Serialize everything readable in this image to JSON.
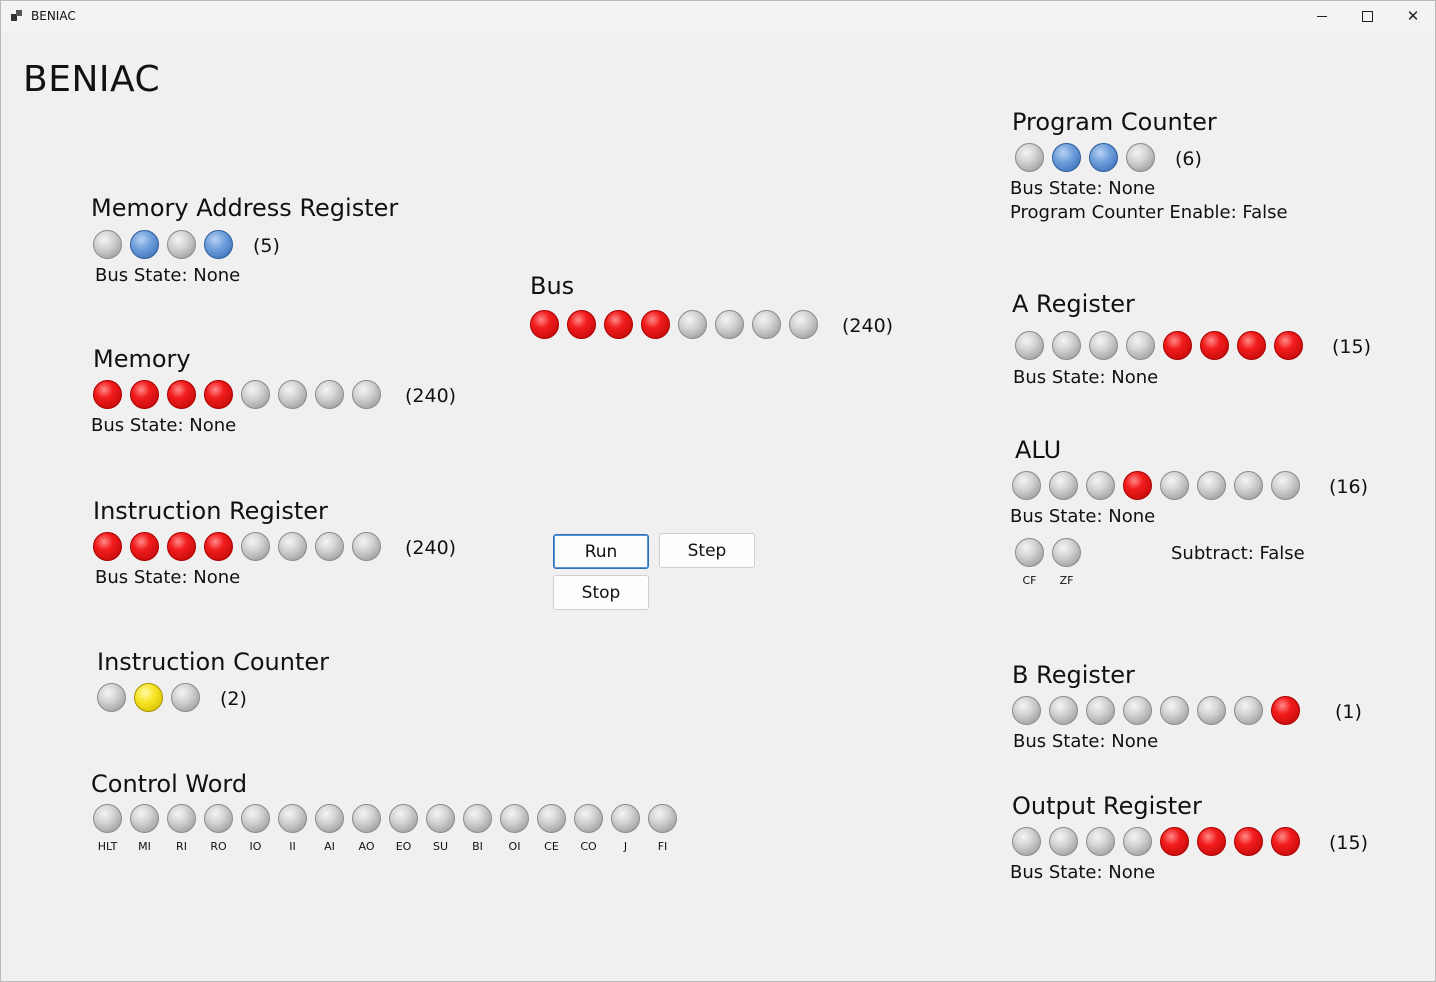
{
  "window": {
    "title": "BENIAC",
    "close_glyph": "✕"
  },
  "app_heading": "BENIAC",
  "colors": {
    "off": "#c0c0c0",
    "red": "#e31414",
    "blue": "#5b8ccf",
    "yellow": "#f2dd1a"
  },
  "mar": {
    "title": "Memory Address Register",
    "leds": [
      "off",
      "blue",
      "off",
      "blue"
    ],
    "value": "(5)",
    "bus_state": "Bus State: None"
  },
  "memory": {
    "title": "Memory",
    "leds": [
      "red",
      "red",
      "red",
      "red",
      "off",
      "off",
      "off",
      "off"
    ],
    "value": "(240)",
    "bus_state": "Bus State: None"
  },
  "ir": {
    "title": "Instruction Register",
    "leds": [
      "red",
      "red",
      "red",
      "red",
      "off",
      "off",
      "off",
      "off"
    ],
    "value": "(240)",
    "bus_state": "Bus State: None"
  },
  "ic": {
    "title": "Instruction Counter",
    "leds": [
      "off",
      "yellow",
      "off"
    ],
    "value": "(2)"
  },
  "control_word": {
    "title": "Control Word",
    "flags": [
      "HLT",
      "MI",
      "RI",
      "RO",
      "IO",
      "II",
      "AI",
      "AO",
      "EO",
      "SU",
      "BI",
      "OI",
      "CE",
      "CO",
      "J",
      "FI"
    ],
    "leds": [
      "off",
      "off",
      "off",
      "off",
      "off",
      "off",
      "off",
      "off",
      "off",
      "off",
      "off",
      "off",
      "off",
      "off",
      "off",
      "off"
    ]
  },
  "bus": {
    "title": "Bus",
    "leds": [
      "red",
      "red",
      "red",
      "red",
      "off",
      "off",
      "off",
      "off"
    ],
    "value": "(240)"
  },
  "buttons": {
    "run": "Run",
    "step": "Step",
    "stop": "Stop"
  },
  "pc": {
    "title": "Program Counter",
    "leds": [
      "off",
      "blue",
      "blue",
      "off"
    ],
    "value": "(6)",
    "bus_state": "Bus State: None",
    "enable": "Program Counter Enable: False"
  },
  "a_reg": {
    "title": "A Register",
    "leds": [
      "off",
      "off",
      "off",
      "off",
      "red",
      "red",
      "red",
      "red"
    ],
    "value": "(15)",
    "bus_state": "Bus State: None"
  },
  "alu": {
    "title": "ALU",
    "leds": [
      "off",
      "off",
      "off",
      "red",
      "off",
      "off",
      "off",
      "off"
    ],
    "value": "(16)",
    "bus_state": "Bus State: None",
    "flag_labels": [
      "CF",
      "ZF"
    ],
    "flag_leds": [
      "off",
      "off"
    ],
    "subtract": "Subtract: False"
  },
  "b_reg": {
    "title": "B Register",
    "leds": [
      "off",
      "off",
      "off",
      "off",
      "off",
      "off",
      "off",
      "red"
    ],
    "value": "(1)",
    "bus_state": "Bus State: None"
  },
  "out_reg": {
    "title": "Output Register",
    "leds": [
      "off",
      "off",
      "off",
      "off",
      "red",
      "red",
      "red",
      "red"
    ],
    "value": "(15)",
    "bus_state": "Bus State: None"
  }
}
